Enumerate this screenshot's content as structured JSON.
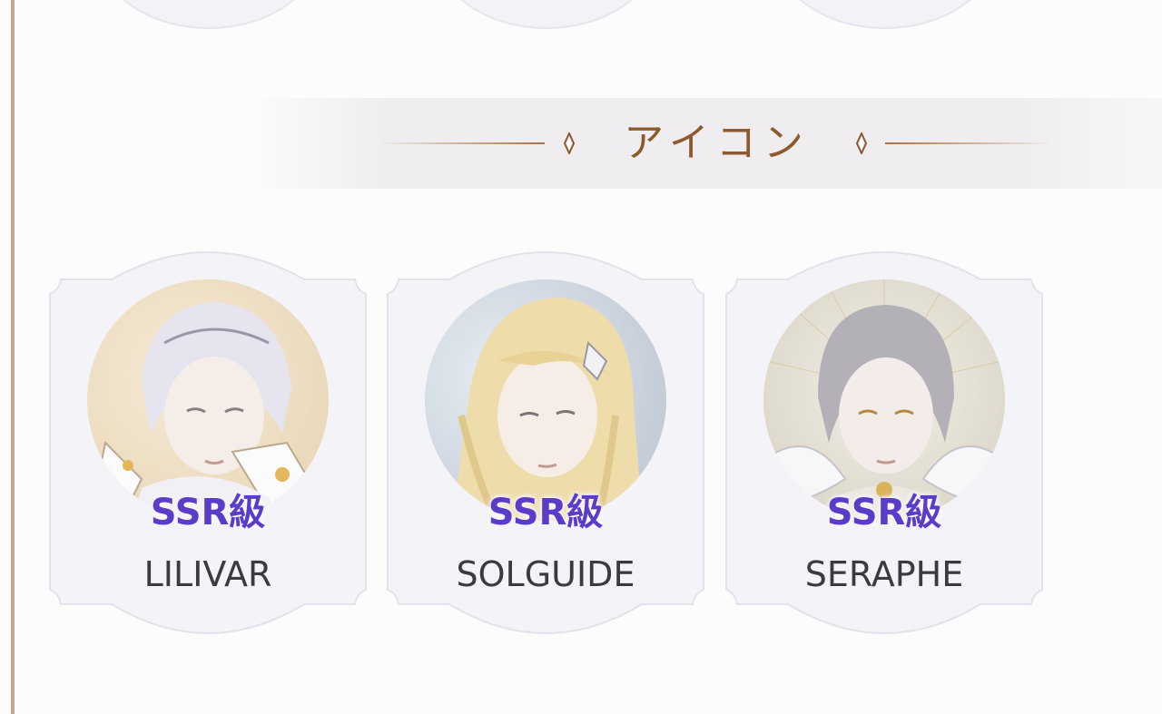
{
  "section": {
    "title": "アイコン"
  },
  "icons": [
    {
      "rarity": "SSR級",
      "name": "LILIVAR"
    },
    {
      "rarity": "SSR級",
      "name": "SOLGUIDE"
    },
    {
      "rarity": "SSR級",
      "name": "SERAPHE"
    }
  ],
  "colors": {
    "accent_gold": "#8c5a2c",
    "rarity_purple": "#5a3cc8",
    "card_bg": "#f3f2f6",
    "side_rule": "#c9a78a"
  }
}
